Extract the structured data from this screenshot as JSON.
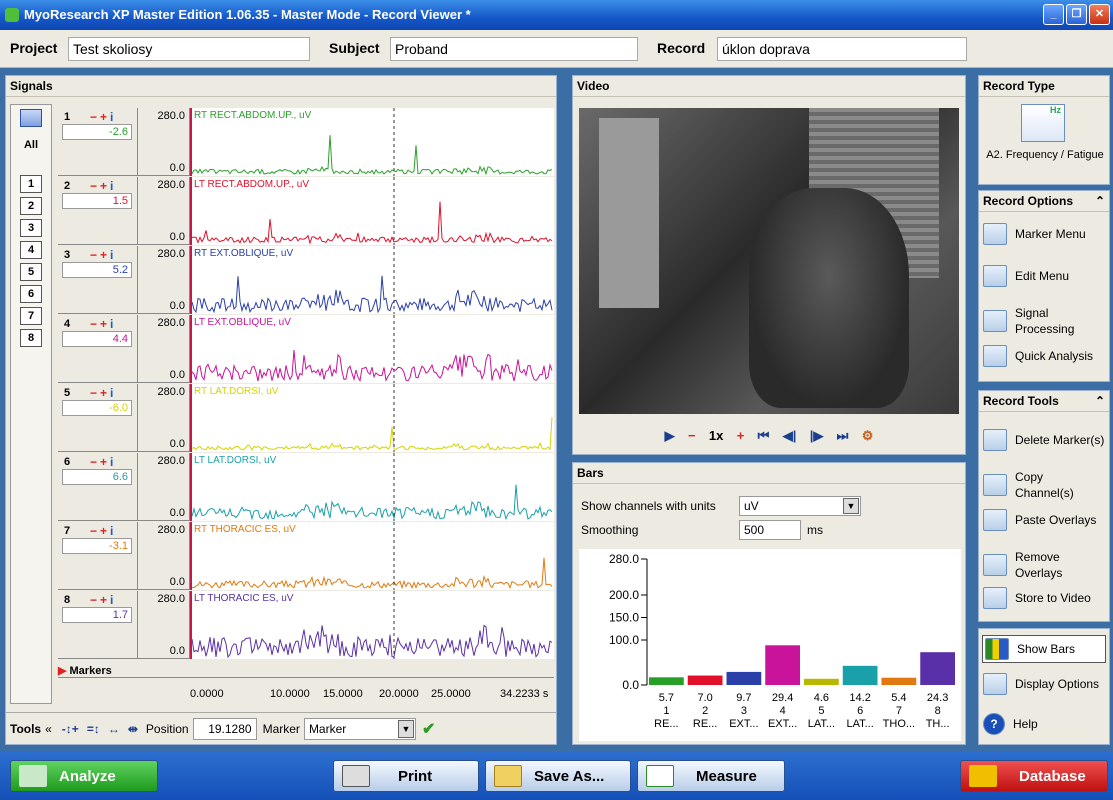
{
  "window": {
    "title": "MyoResearch XP Master Edition 1.06.35 - Master Mode - Record Viewer *",
    "btn_min": "_",
    "btn_max": "❐",
    "btn_close": "✕"
  },
  "info": {
    "project_label": "Project",
    "project_value": "Test skoliosy",
    "subject_label": "Subject",
    "subject_value": "Proband",
    "record_label": "Record",
    "record_value": "úklon doprava"
  },
  "signals": {
    "title": "Signals",
    "all_label": "All",
    "channel_buttons": [
      "1",
      "2",
      "3",
      "4",
      "5",
      "6",
      "7",
      "8"
    ],
    "channels": [
      {
        "num": "1",
        "value": "-2.6",
        "max": "280.0",
        "min": "0.0",
        "label": "RT RECT.ABDOM.UP., uV",
        "color": "#2aa02a",
        "amp": 0.12
      },
      {
        "num": "2",
        "value": "1.5",
        "max": "280.0",
        "min": "0.0",
        "label": "LT RECT.ABDOM.UP., uV",
        "color": "#e0102a",
        "amp": 0.15
      },
      {
        "num": "3",
        "value": "5.2",
        "max": "280.0",
        "min": "0.0",
        "label": "RT EXT.OBLIQUE, uV",
        "color": "#2a3fa8",
        "amp": 0.35
      },
      {
        "num": "4",
        "value": "4.4",
        "max": "280.0",
        "min": "0.0",
        "label": "LT EXT.OBLIQUE, uV",
        "color": "#c8139a",
        "amp": 0.42
      },
      {
        "num": "5",
        "value": "-6.0",
        "max": "280.0",
        "min": "0.0",
        "label": "RT LAT.DORSI, uV",
        "color": "#d4d400",
        "amp": 0.1
      },
      {
        "num": "6",
        "value": "6.6",
        "max": "280.0",
        "min": "0.0",
        "label": "LT LAT.DORSI, uV",
        "color": "#1aa0a8",
        "amp": 0.3
      },
      {
        "num": "7",
        "value": "-3.1",
        "max": "280.0",
        "min": "0.0",
        "label": "RT THORACIC ES, uV",
        "color": "#e07a10",
        "amp": 0.18
      },
      {
        "num": "8",
        "value": "1.7",
        "max": "280.0",
        "min": "0.0",
        "label": "LT THORACIC ES, uV",
        "color": "#5a30a8",
        "amp": 0.5
      }
    ],
    "markers_label": "Markers",
    "time_ticks": [
      "0.0000",
      "10.0000",
      "15.0000",
      "20.0000",
      "25.0000",
      "34.2233 s"
    ],
    "tools_label": "Tools",
    "position_label": "Position",
    "position_value": "19.1280",
    "marker_label": "Marker",
    "marker_value": "Marker"
  },
  "video": {
    "title": "Video",
    "speed": "1x"
  },
  "bars": {
    "title": "Bars",
    "show_label": "Show channels with units",
    "units_value": "uV",
    "smoothing_label": "Smoothing",
    "smoothing_value": "500",
    "smoothing_unit": "ms"
  },
  "chart_data": {
    "type": "bar",
    "categories": [
      "1\nRE...",
      "2\nRE...",
      "3\nEXT...",
      "4\nEXT...",
      "5\nLAT...",
      "6\nLAT...",
      "7\nTHO...",
      "8\nTH..."
    ],
    "values": [
      5.7,
      7.0,
      9.7,
      29.4,
      4.6,
      14.2,
      5.4,
      24.3
    ],
    "value_labels": [
      "5.7",
      "7.0",
      "9.7",
      "29.4",
      "4.6",
      "14.2",
      "5.4",
      "24.3"
    ],
    "cat_nums": [
      "1",
      "2",
      "3",
      "4",
      "5",
      "6",
      "7",
      "8"
    ],
    "cat_names": [
      "RE...",
      "RE...",
      "EXT...",
      "EXT...",
      "LAT...",
      "LAT...",
      "THO...",
      "TH..."
    ],
    "colors": [
      "#28a028",
      "#e0102a",
      "#2a3fa8",
      "#c8139a",
      "#b8b800",
      "#1aa0a8",
      "#e07a10",
      "#5a30a8"
    ],
    "yticks": [
      "280.0",
      "200.0",
      "150.0",
      "100.0",
      "0.0"
    ],
    "ylim": [
      0,
      280
    ]
  },
  "record_type": {
    "title": "Record Type",
    "label": "A2. Frequency / Fatigue",
    "icon_text": "Hz"
  },
  "record_options": {
    "title": "Record Options",
    "items": [
      "Marker Menu",
      "Edit Menu",
      "Signal Processing",
      "Quick Analysis"
    ]
  },
  "record_tools": {
    "title": "Record Tools",
    "items": [
      "Delete Marker(s)",
      "Copy Channel(s)",
      "Paste Overlays",
      "Remove Overlays",
      "Store to Video"
    ]
  },
  "side_bottom": {
    "show_bars": "Show Bars",
    "display_options": "Display Options",
    "help": "Help"
  },
  "bottom": {
    "analyze": "Analyze",
    "print": "Print",
    "save_as": "Save As...",
    "measure": "Measure",
    "database": "Database"
  }
}
